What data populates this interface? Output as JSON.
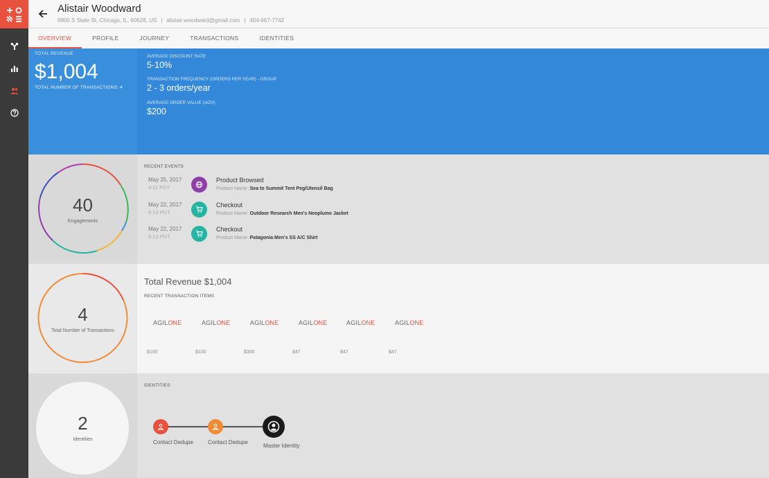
{
  "app": {
    "logo": "agilone-logo"
  },
  "sidebar": {
    "items": [
      {
        "icon": "connections-icon",
        "active": false
      },
      {
        "icon": "bar-chart-icon",
        "active": false
      },
      {
        "icon": "people-icon",
        "active": true
      },
      {
        "icon": "help-icon",
        "active": false
      }
    ]
  },
  "header": {
    "name": "Alistair Woodward",
    "address": "9900 S State St,  Chicago, IL, 60628, US",
    "email": "alistair.woodward@gmail.com",
    "phone": "404-667-7742",
    "separator": "|"
  },
  "tabs": [
    {
      "label": "OVERVIEW",
      "active": true
    },
    {
      "label": "PROFILE",
      "active": false
    },
    {
      "label": "JOURNEY",
      "active": false
    },
    {
      "label": "TRANSACTIONS",
      "active": false
    },
    {
      "label": "IDENTITIES",
      "active": false
    }
  ],
  "summary": {
    "total_revenue_label": "TOTAL REVENUE",
    "total_revenue_value": "$1,004",
    "transactions_count_label": "TOTAL NUMBER OF TRANSACTIONS: 4",
    "metrics": [
      {
        "label": "AVERAGE DISCOUNT RATE",
        "value": "5-10%"
      },
      {
        "label": "TRANSACTION FREQUENCY (ORDERS PER YEAR) - GROUP",
        "value": "2 - 3 orders/year"
      },
      {
        "label": "AVERAGE ORDER VALUE (AOV)",
        "value": "$200"
      }
    ]
  },
  "engagements": {
    "count": "40",
    "label": "Engagements"
  },
  "recent_events": {
    "title": "RECENT EVENTS",
    "items": [
      {
        "date": "May 25, 2017",
        "time": "4:11 PDT",
        "type": "Product Browsed",
        "icon": "globe-icon",
        "color": "#8e3ea8",
        "detail_label": "Product Name :",
        "detail_value": "Sea to Summit Tent Peg/Utensil Bag"
      },
      {
        "date": "May 22, 2017",
        "time": "8:13 PDT",
        "type": "Checkout",
        "icon": "cart-icon",
        "color": "#26b5a2",
        "detail_label": "Product Name :",
        "detail_value": "Outdoor Research Men's Neoplume Jacket"
      },
      {
        "date": "May 22, 2017",
        "time": "8:13 PDT",
        "type": "Checkout",
        "icon": "cart-icon",
        "color": "#26b5a2",
        "detail_label": "Product Name :",
        "detail_value": "Patagonia Men's SS A/C Shirt"
      }
    ]
  },
  "transactions": {
    "count": "4",
    "label": "Total Number of Transactions",
    "title": "Total Revenue $1,004",
    "items_title": "RECENT TRANSACTION ITEMS",
    "logo_a": "AGIL",
    "logo_b": "ONE",
    "items": [
      {
        "price": "$100"
      },
      {
        "price": "$100"
      },
      {
        "price": "$300"
      },
      {
        "price": "$47"
      },
      {
        "price": "$47"
      },
      {
        "price": "$47"
      }
    ]
  },
  "identities": {
    "count": "2",
    "label": "Identities",
    "title": "IDENTITIES",
    "nodes": [
      {
        "label": "Contact Dedupe",
        "color": "#e8513d"
      },
      {
        "label": "Contact Dedupe",
        "color": "#f08c35"
      },
      {
        "label": "Master Identity",
        "color": "#1a1a1a"
      }
    ]
  }
}
